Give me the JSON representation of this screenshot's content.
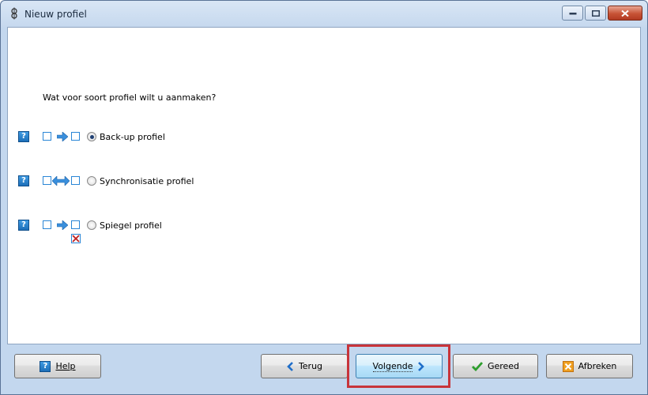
{
  "window": {
    "title": "Nieuw profiel",
    "icon": "app-gear-icon"
  },
  "main": {
    "question": "Wat voor soort profiel wilt u aanmaken?",
    "options": [
      {
        "label": "Back-up profiel",
        "selected": true,
        "diagram": "one-way-arrow"
      },
      {
        "label": "Synchronisatie profiel",
        "selected": false,
        "diagram": "two-way-arrow"
      },
      {
        "label": "Spiegel profiel",
        "selected": false,
        "diagram": "one-way-arrow-with-delete"
      }
    ],
    "help_glyph": "?"
  },
  "footer": {
    "help_label": "Help",
    "back_label": "Terug",
    "next_label": "Volgende",
    "finish_label": "Gereed",
    "cancel_label": "Afbreken"
  },
  "colors": {
    "accent": "#2a86d6",
    "highlight": "#c8343a",
    "window_bg": "#c3d7ee"
  }
}
